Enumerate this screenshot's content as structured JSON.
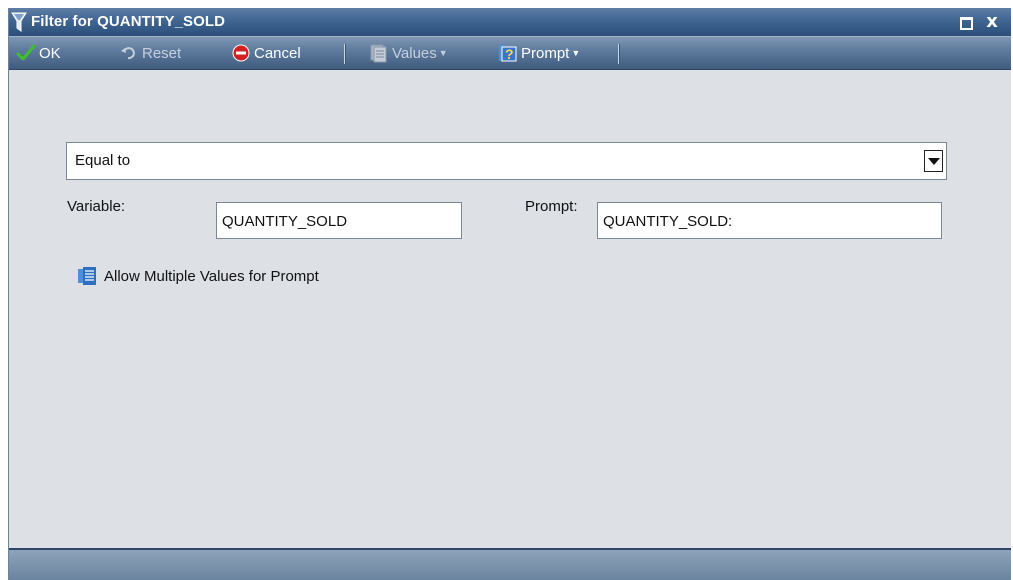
{
  "window": {
    "title": "Filter for QUANTITY_SOLD",
    "close_glyph": "x"
  },
  "toolbar": {
    "ok_label": "OK",
    "reset_label": "Reset",
    "cancel_label": "Cancel",
    "values_label": "Values",
    "prompt_label": "Prompt"
  },
  "filter": {
    "operator": "Equal to",
    "variable_label": "Variable:",
    "variable_value": "QUANTITY_SOLD",
    "prompt_label": "Prompt:",
    "prompt_value": "QUANTITY_SOLD:",
    "multi_values_label": "Allow Multiple Values for Prompt"
  },
  "colors": {
    "title_bar": "#3f6592",
    "toolbar": "#5f7b9d",
    "body": "#dde1e6",
    "ok_check": "#3fbf2b",
    "cancel_red": "#d42020"
  },
  "icons": {
    "title": "filter-funnel-icon",
    "ok": "checkmark-icon",
    "reset": "reset-arrow-icon",
    "cancel": "cancel-stop-icon",
    "values": "values-list-icon",
    "prompt": "prompt-question-icon",
    "multi_values": "multi-values-list-icon"
  }
}
